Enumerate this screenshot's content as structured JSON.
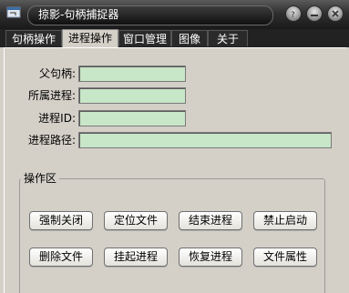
{
  "window": {
    "title": "掠影-句柄捕捉器"
  },
  "tabs": [
    {
      "label": "句柄操作"
    },
    {
      "label": "进程操作"
    },
    {
      "label": "窗口管理"
    },
    {
      "label": "图像"
    },
    {
      "label": "关于"
    }
  ],
  "active_tab": "进程操作",
  "fields": {
    "parent_handle": {
      "label": "父句柄:",
      "value": ""
    },
    "process": {
      "label": "所属进程:",
      "value": ""
    },
    "pid": {
      "label": "进程ID:",
      "value": ""
    },
    "path": {
      "label": "进程路径:",
      "value": ""
    }
  },
  "group": {
    "title": "操作区",
    "buttons": [
      "强制关闭",
      "定位文件",
      "结束进程",
      "禁止启动",
      "删除文件",
      "挂起进程",
      "恢复进程",
      "文件属性"
    ]
  },
  "colors": {
    "field_bg": "#c8e6c8",
    "titlebar": "#1a1a1a"
  }
}
